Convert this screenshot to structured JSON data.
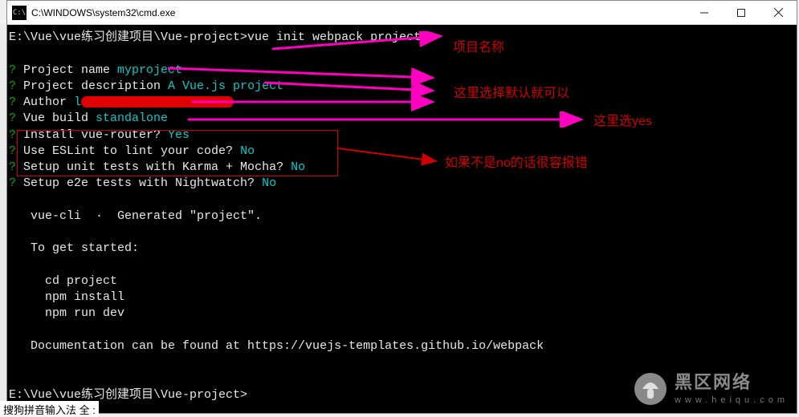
{
  "window": {
    "title": "C:\\WINDOWS\\system32\\cmd.exe",
    "icon_label": "C:\\"
  },
  "prompt1": {
    "path": "E:\\Vue\\vue练习创建项目\\Vue-project>",
    "command": "vue init webpack project"
  },
  "questions": {
    "q1_label": "Project name ",
    "q1_ans": "myproject",
    "q2_label": "Project description ",
    "q2_ans": "A Vue.js project",
    "q3_label": "Author ",
    "q3_prefix": "l",
    "q4_label": "Vue build ",
    "q4_ans": "standalone",
    "q5_label": "Install vue-router? ",
    "q5_ans": "Yes",
    "q6_label": "Use ESLint to lint your code? ",
    "q6_ans": "No",
    "q7_label": "Setup unit tests with Karma + Mocha? ",
    "q7_ans": "No",
    "q8_label": "Setup e2e tests with Nightwatch? ",
    "q8_ans": "No"
  },
  "output": {
    "generated": "   vue-cli  ·  Generated \"project\".",
    "get_started": "   To get started:",
    "step1": "     cd project",
    "step2": "     npm install",
    "step3": "     npm run dev",
    "docs": "   Documentation can be found at https://vuejs-templates.github.io/webpack"
  },
  "prompt2": {
    "path": "E:\\Vue\\vue练习创建项目\\Vue-project>"
  },
  "annotations": {
    "a1": "项目名称",
    "a2": "这里选择默认就可以",
    "a3": "这里选yes",
    "a4": "如果不是no的话很容报错"
  },
  "ime": "搜狗拼音输入法  全 :",
  "watermark": {
    "main": "黑区网络",
    "sub": "www.heiqu.com"
  },
  "colors": {
    "arrow_pink": "#ff00c0",
    "arrow_red": "#d00000"
  }
}
